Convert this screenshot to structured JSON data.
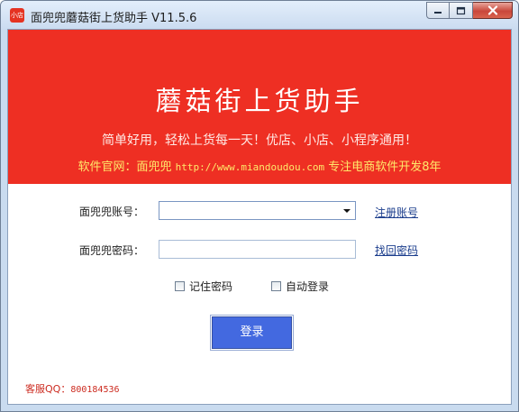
{
  "window": {
    "app_icon_text": "小店",
    "title": "面兜兜蘑菇街上货助手 V11.5.6",
    "minimize_glyph": "‒",
    "maximize_glyph": "□",
    "close_glyph": "✕"
  },
  "banner": {
    "title": "蘑菇街上货助手",
    "slogan": "简单好用，轻松上货每一天！优店、小店、小程序通用！",
    "site_prefix": "软件官网：面兜兜 ",
    "site_url": "http://www.miandoudou.com",
    "site_suffix": " 专注电商软件开发8年"
  },
  "login": {
    "account_label": "面兜兜账号：",
    "account_value": "",
    "register_link": "注册账号",
    "password_label": "面兜兜密码：",
    "password_value": "",
    "recover_link": "找回密码",
    "remember_label": "记住密码",
    "remember_checked": false,
    "autologin_label": "自动登录",
    "autologin_checked": false,
    "submit_label": "登录"
  },
  "footer": {
    "qq_label": "客服QQ：",
    "qq_number": "800184536"
  },
  "colors": {
    "banner_bg": "#ee2f23",
    "banner_site_text": "#ffe86a",
    "login_button": "#4369e0",
    "footer_text": "#cc2a1f"
  }
}
